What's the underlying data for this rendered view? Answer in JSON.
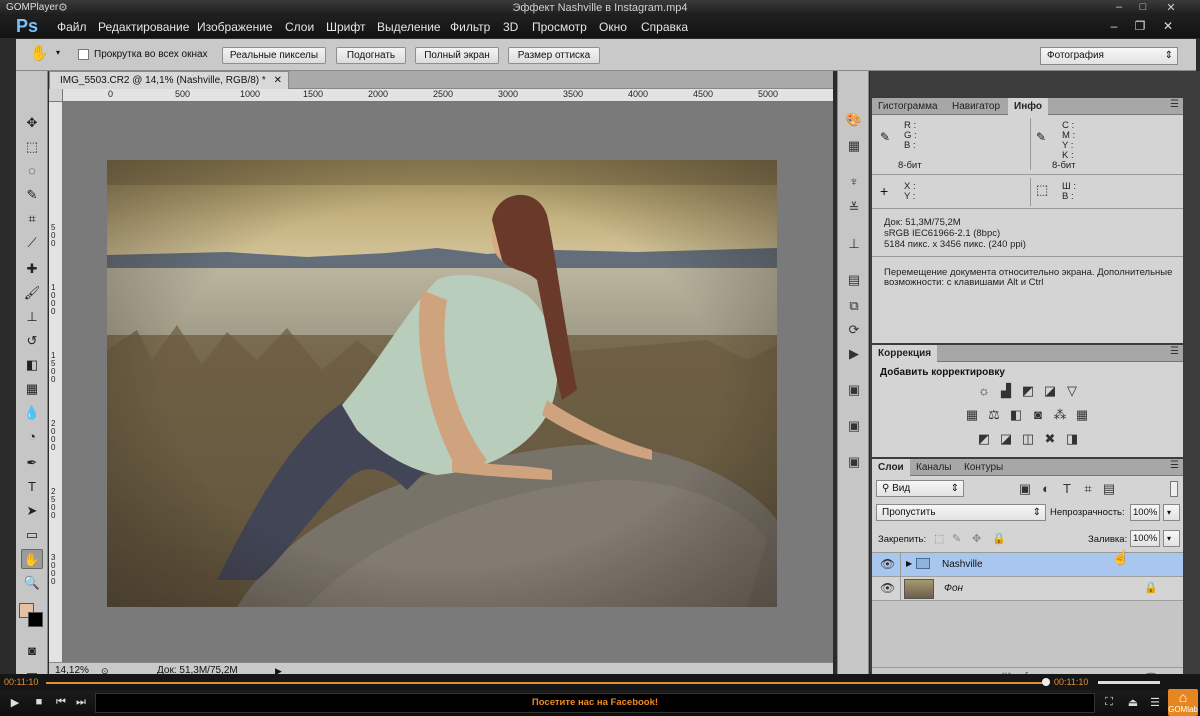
{
  "player": {
    "logo": "GOM",
    "logo_suffix": "Player",
    "title": "Эффект Nashville в Instagram.mp4",
    "time_current": "00:11:10",
    "time_total": "00:11:10",
    "progress": 1.0,
    "ticker": "Посетите нас на Facebook!",
    "gomlab": "GOMlab",
    "accent_color": "#e8902c"
  },
  "ps": {
    "logo": "Ps",
    "menu": [
      "Файл",
      "Редактирование",
      "Изображение",
      "Слои",
      "Шрифт",
      "Выделение",
      "Фильтр",
      "3D",
      "Просмотр",
      "Окно",
      "Справка"
    ],
    "options": {
      "scroll_all": "Прокрутка во всех окнах",
      "actual_pixels": "Реальные пикселы",
      "fit": "Подогнать",
      "full_screen": "Полный экран",
      "print_size": "Размер оттиска",
      "workspace": "Фотография"
    },
    "document": {
      "tab_title": "IMG_5503.CR2 @ 14,1% (Nashville, RGB/8) *",
      "ruler_top": [
        "0",
        "500",
        "1000",
        "1500",
        "2000",
        "2500",
        "3000",
        "3500",
        "4000",
        "4500",
        "5000"
      ],
      "ruler_left": [
        "5 0 0",
        "1 0 0 0",
        "1 5 0 0",
        "2 0 0 0",
        "2 5 0 0",
        "3 0 0 0"
      ],
      "zoom": "14,12%",
      "doc_status": "Док: 51,3M/75,2M"
    },
    "info_panel": {
      "tabs": [
        "Гистограмма",
        "Навигатор",
        "Инфо"
      ],
      "rgb_labels": [
        "R :",
        "G :",
        "B :"
      ],
      "cmyk_labels": [
        "C :",
        "M :",
        "Y :",
        "K :"
      ],
      "bit_left": "8-бит",
      "bit_right": "8-бит",
      "xy_labels": [
        "X :",
        "Y :"
      ],
      "wh_labels": [
        "Ш :",
        "В :"
      ],
      "doc_line": "Док: 51,3M/75,2M",
      "profile_line": "sRGB IEC61966-2.1 (8bpc)",
      "size_line": "5184 пикс. x 3456 пикс. (240 ppi)",
      "hint": "Перемещение документа относительно экрана. Дополнительные возможности: с клавишами Alt и Ctrl"
    },
    "adjust_panel": {
      "tab": "Коррекция",
      "heading": "Добавить корректировку"
    },
    "layers_panel": {
      "tabs": [
        "Слои",
        "Каналы",
        "Контуры"
      ],
      "filter": "Вид",
      "blend_mode": "Пропустить",
      "opacity_label": "Непрозрачность:",
      "opacity_value": "100%",
      "lock_label": "Закрепить:",
      "fill_label": "Заливка:",
      "fill_value": "100%",
      "layers": [
        {
          "name": "Nashville",
          "type": "group",
          "selected": true
        },
        {
          "name": "Фон",
          "type": "image",
          "locked": true
        }
      ]
    }
  }
}
